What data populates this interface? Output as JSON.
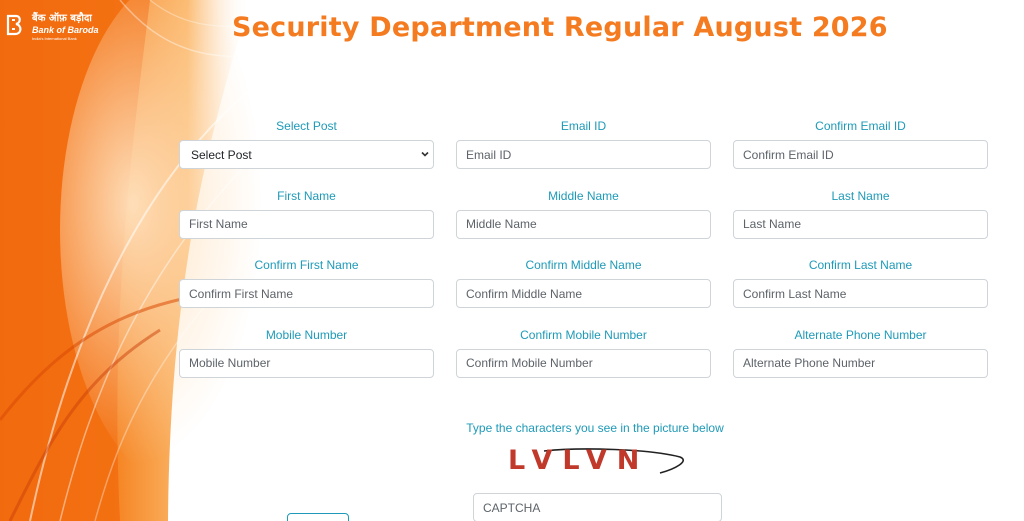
{
  "brand": {
    "hindi_name": "बैंक ऑफ़ बड़ौदा",
    "english_name": "Bank of Baroda",
    "tagline": "India's International Bank",
    "logo_icon": "bank-of-baroda-logo-icon"
  },
  "page": {
    "title": "Security Department Regular August 2026"
  },
  "colors": {
    "title": "#f47b20",
    "label": "#1e9ab8",
    "background_accent": "#f26d0f"
  },
  "form": {
    "select_post": {
      "label": "Select Post",
      "selected": "Select Post",
      "options": [
        "Select Post"
      ]
    },
    "email": {
      "label": "Email ID",
      "placeholder": "Email ID",
      "value": ""
    },
    "confirm_email": {
      "label": "Confirm Email ID",
      "placeholder": "Confirm Email ID",
      "value": ""
    },
    "first_name": {
      "label": "First Name",
      "placeholder": "First Name",
      "value": ""
    },
    "middle_name": {
      "label": "Middle Name",
      "placeholder": "Middle Name",
      "value": ""
    },
    "last_name": {
      "label": "Last Name",
      "placeholder": "Last Name",
      "value": ""
    },
    "confirm_first_name": {
      "label": "Confirm First Name",
      "placeholder": "Confirm First Name",
      "value": ""
    },
    "confirm_middle_name": {
      "label": "Confirm Middle Name",
      "placeholder": "Confirm Middle Name",
      "value": ""
    },
    "confirm_last_name": {
      "label": "Confirm Last Name",
      "placeholder": "Confirm Last Name",
      "value": ""
    },
    "mobile": {
      "label": "Mobile Number",
      "placeholder": "Mobile Number",
      "value": ""
    },
    "confirm_mobile": {
      "label": "Confirm Mobile Number",
      "placeholder": "Confirm Mobile Number",
      "value": ""
    },
    "alternate_phone": {
      "label": "Alternate Phone Number",
      "placeholder": "Alternate Phone Number",
      "value": ""
    }
  },
  "captcha": {
    "label": "Type the characters you see in the picture below",
    "image_text": "LVLVN",
    "placeholder": "CAPTCHA",
    "value": ""
  }
}
